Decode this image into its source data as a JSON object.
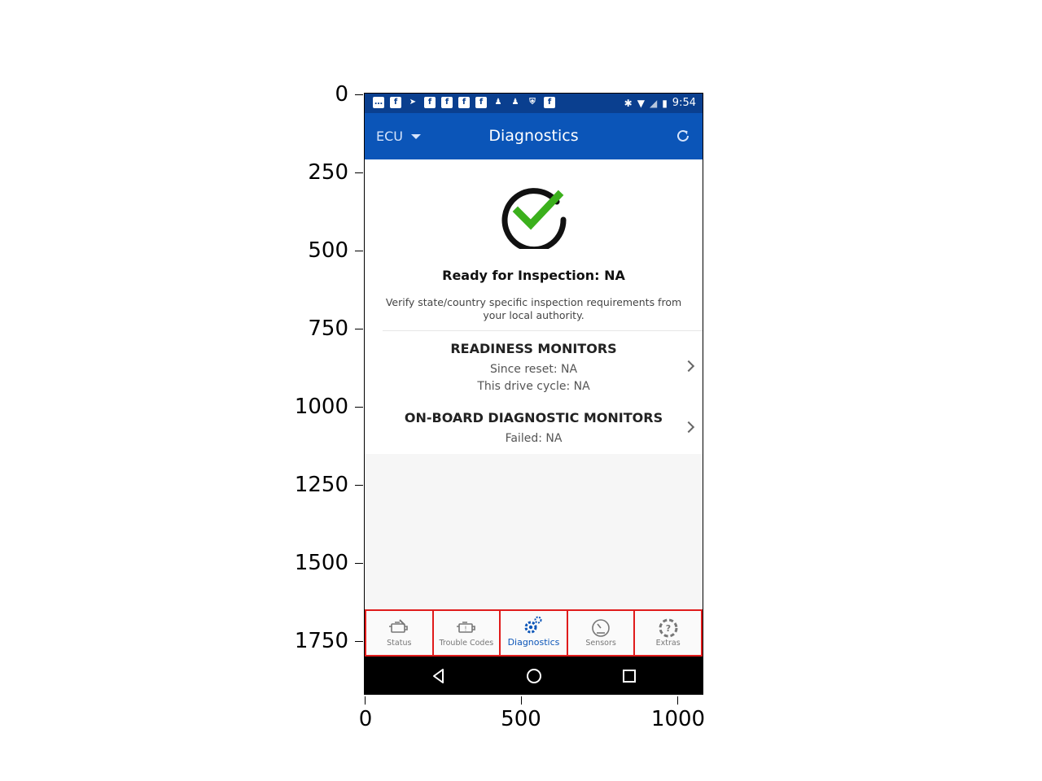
{
  "axes": {
    "y_ticks": [
      "0",
      "250",
      "500",
      "750",
      "1000",
      "1250",
      "1500",
      "1750"
    ],
    "x_ticks": [
      "0",
      "500",
      "1000"
    ]
  },
  "status_bar": {
    "left_icons": [
      "chat-icon",
      "facebook-icon",
      "send-icon",
      "facebook-icon",
      "facebook-icon",
      "facebook-icon",
      "facebook-icon",
      "person-icon",
      "person-icon",
      "shield-icon",
      "facebook-icon"
    ],
    "right_icons": [
      "bluetooth-icon",
      "wifi-icon",
      "no-signal-icon",
      "battery-icon"
    ],
    "time": "9:54"
  },
  "app_bar": {
    "ecu_label": "ECU",
    "title": "Diagnostics",
    "accent": "#0b55b8"
  },
  "summary": {
    "ready_title": "Ready for Inspection: NA",
    "verify_text": "Verify state/country specific inspection requirements from your local authority.",
    "check_color": "#3bb01c"
  },
  "readiness": {
    "title": "READINESS MONITORS",
    "since_reset": "Since reset: NA",
    "drive_cycle": "This drive cycle: NA"
  },
  "onboard": {
    "title": "ON-BOARD DIAGNOSTIC MONITORS",
    "failed": "Failed: NA"
  },
  "bottom_nav": {
    "tabs": [
      {
        "label": "Status",
        "icon": "engine-status-icon",
        "active": false
      },
      {
        "label": "Trouble Codes",
        "icon": "engine-codes-icon",
        "active": false
      },
      {
        "label": "Diagnostics",
        "icon": "gears-icon",
        "active": true
      },
      {
        "label": "Sensors",
        "icon": "gauge-icon",
        "active": false
      },
      {
        "label": "Extras",
        "icon": "help-icon",
        "active": false
      }
    ]
  }
}
